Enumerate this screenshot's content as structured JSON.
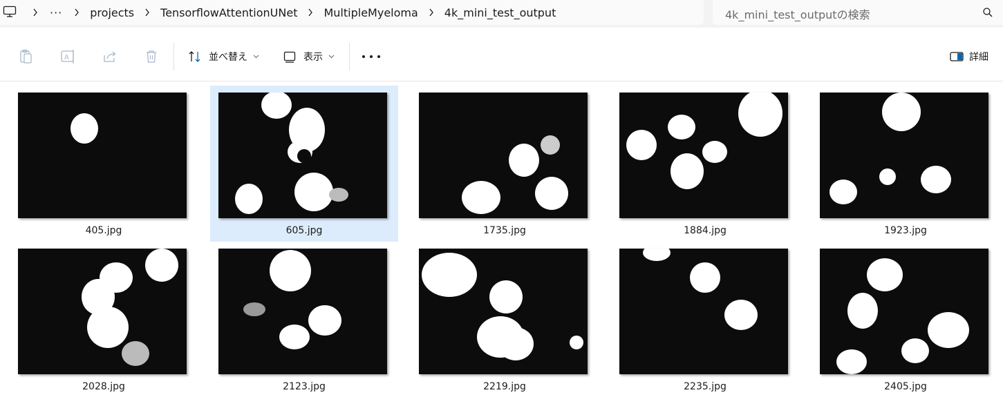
{
  "address": {
    "overflow": "···",
    "crumbs": [
      "projects",
      "TensorflowAttentionUNet",
      "MultipleMyeloma",
      "4k_mini_test_output"
    ]
  },
  "search": {
    "placeholder": "4k_mini_test_outputの検索"
  },
  "toolbar": {
    "sort_label": "並べ替え",
    "view_label": "表示",
    "details_label": "詳細"
  },
  "files": [
    {
      "name": "405.jpg",
      "selected": false
    },
    {
      "name": "605.jpg",
      "selected": true
    },
    {
      "name": "1735.jpg",
      "selected": false
    },
    {
      "name": "1884.jpg",
      "selected": false
    },
    {
      "name": "1923.jpg",
      "selected": false
    },
    {
      "name": "2028.jpg",
      "selected": false
    },
    {
      "name": "2123.jpg",
      "selected": false
    },
    {
      "name": "2219.jpg",
      "selected": false
    },
    {
      "name": "2235.jpg",
      "selected": false
    },
    {
      "name": "2405.jpg",
      "selected": false
    }
  ],
  "colors": {
    "selection": "#dcecfc",
    "accent": "#0067c0",
    "thumb_bg": "#0c0c0c"
  }
}
